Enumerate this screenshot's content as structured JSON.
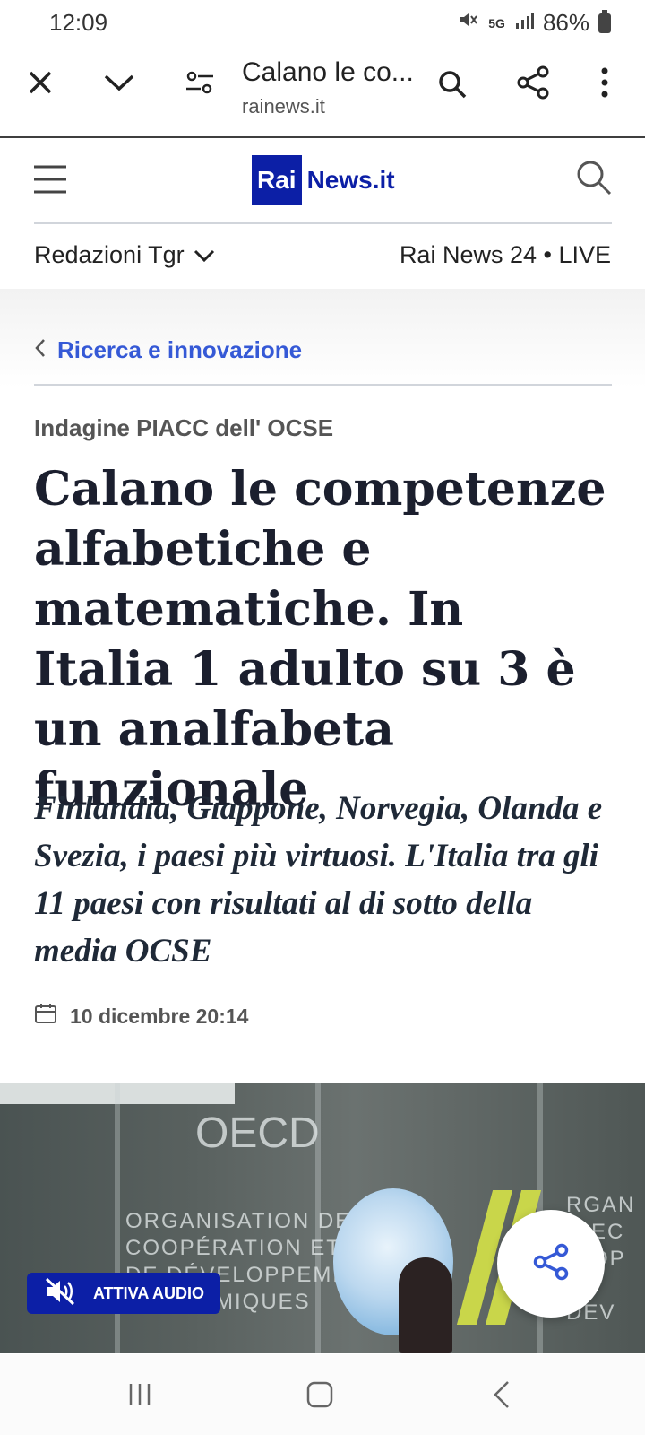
{
  "status_bar": {
    "time": "12:09",
    "network": "5G",
    "battery": "86%"
  },
  "browser": {
    "tab_title": "Calano le co...",
    "url": "rainews.it"
  },
  "site": {
    "logo_rai": "Rai",
    "logo_news": "News.it",
    "menu_redazioni": "Redazioni Tgr",
    "live_link": "Rai News 24 • LIVE"
  },
  "article": {
    "breadcrumb": "Ricerca e innovazione",
    "kicker": "Indagine PIACC dell' OCSE",
    "headline": "Calano le competenze alfabetiche e matematiche. In Italia 1 adulto su 3 è un analfabeta funzionale",
    "subtitle": "Finlandia, Giappone, Norvegia, Olanda e Svezia, i paesi più virtuosi. L'Italia tra gli 11 paesi con risultati al di sotto della media OCSE",
    "date": "10 dicembre 20:14"
  },
  "hero": {
    "audio_button": "ATTIVA AUDIO",
    "sign_oecd": "OECD",
    "sign_lines": [
      "ORGANISATION DE",
      "COOPÉRATION ET",
      "DE DÉVELOPPEMENT",
      "MIQUES"
    ],
    "sign_right": [
      "RGAN",
      "EC",
      "OP",
      "ND DEV"
    ]
  },
  "colors": {
    "brand": "#0c1fa6",
    "link": "#3559d6"
  }
}
